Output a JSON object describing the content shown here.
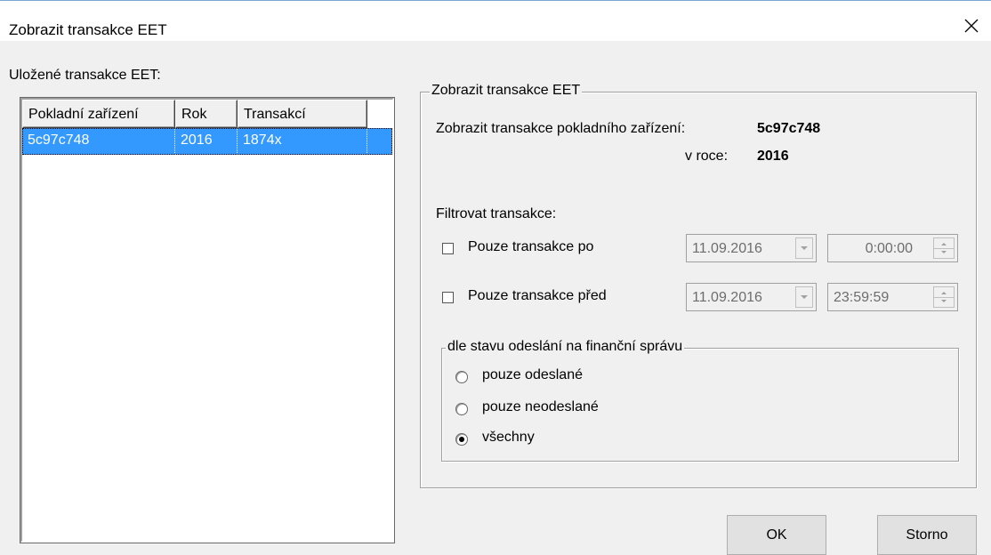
{
  "window": {
    "title": "Zobrazit transakce EET"
  },
  "list": {
    "label": "Uložené transakce EET:",
    "columns": [
      "Pokladní zařízení",
      "Rok",
      "Transakcí"
    ],
    "rows": [
      {
        "device": "5c97c748",
        "year": "2016",
        "count": "1874x",
        "selected": true
      }
    ]
  },
  "panel": {
    "title": "Zobrazit transakce EET",
    "device_label": "Zobrazit transakce pokladního zařízení:",
    "device_value": "5c97c748",
    "year_label": "v roce:",
    "year_value": "2016",
    "filter_label": "Filtrovat transakce:",
    "after": {
      "label": "Pouze transakce po",
      "checked": false,
      "date": "11.09.2016",
      "time": "0:00:00"
    },
    "before": {
      "label": "Pouze transakce před",
      "checked": false,
      "date": "11.09.2016",
      "time": "23:59:59"
    },
    "state_group": {
      "title": "dle stavu odeslání na finanční správu",
      "options": [
        {
          "label": "pouze odeslané",
          "checked": false
        },
        {
          "label": "pouze neodeslané",
          "checked": false
        },
        {
          "label": "všechny",
          "checked": true
        }
      ]
    }
  },
  "buttons": {
    "ok": "OK",
    "cancel": "Storno"
  },
  "icons": {
    "close": "close-icon",
    "dropdown": "chevron-down-icon",
    "spin": "spin-updown-icon"
  },
  "colors": {
    "selection": "#3399ff",
    "dialog_bg": "#f0f0f0"
  }
}
